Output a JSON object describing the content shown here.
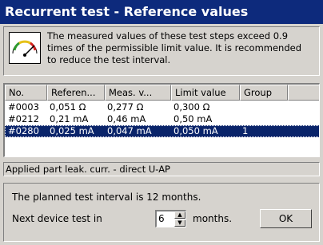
{
  "window": {
    "title": "Recurrent test - Reference values"
  },
  "info": {
    "icon": "gauge-icon",
    "lines": [
      "The measured values of these test steps exceed 0.9",
      "times of the permissible limit value. It is recommended",
      "to reduce the test interval."
    ]
  },
  "table": {
    "columns": [
      "No.",
      "Referen...",
      "Meas. v...",
      "Limit value",
      "Group"
    ],
    "rows": [
      {
        "no": "#0003",
        "ref": "0,051 Ω",
        "meas": "0,277 Ω",
        "limit": "0,300 Ω",
        "group": ""
      },
      {
        "no": "#0212",
        "ref": "0,21 mA",
        "meas": "0,46 mA",
        "limit": "0,50 mA",
        "group": ""
      },
      {
        "no": "#0280",
        "ref": "0,025 mA",
        "meas": "0,047 mA",
        "limit": "0,050 mA",
        "group": "1"
      }
    ],
    "selected_row": 2
  },
  "status": {
    "text": "Applied part leak. curr. - direct U-AP"
  },
  "interval": {
    "planned_text": "The planned test interval is 12 months.",
    "next_label": "Next device test in",
    "value": "6",
    "unit": "months.",
    "ok_label": "OK"
  },
  "colors": {
    "title_bg": "#0d2a7c",
    "selection": "#0a246a",
    "face": "#d6d3ce"
  }
}
